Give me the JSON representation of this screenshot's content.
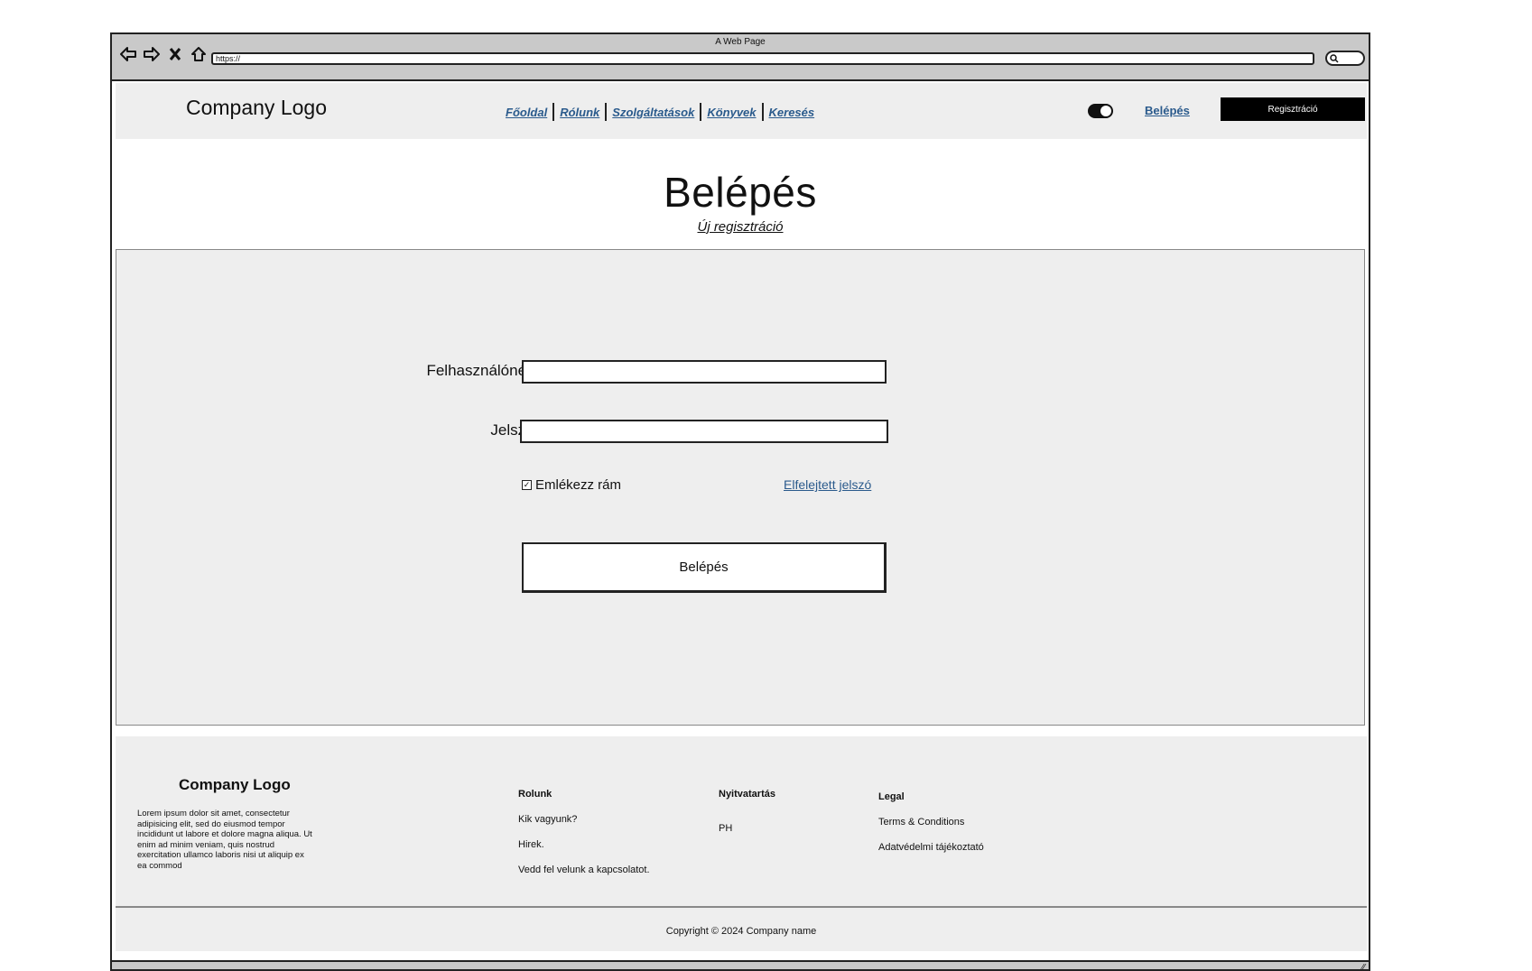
{
  "window": {
    "title": "A Web Page",
    "url": "https://"
  },
  "icons": {
    "back": "back-arrow-icon",
    "forward": "forward-arrow-icon",
    "stop": "close-icon",
    "home": "home-icon",
    "search": "search-icon"
  },
  "header": {
    "logo": "Company Logo",
    "nav": [
      "Főoldal",
      "Rólunk",
      "Szolgáltatások",
      "Könyvek",
      "Keresés"
    ],
    "login_link": "Belépés",
    "register_button": "Regisztráció"
  },
  "main": {
    "title": "Belépés",
    "subtitle_link": "Új regisztráció"
  },
  "form": {
    "username_label": "Felhasználónév :",
    "username_value": "",
    "password_label": "Jelszó :",
    "password_value": "",
    "remember_label": "Emlékezz rám",
    "remember_checked": true,
    "forgot_link": "Elfelejtett jelszó",
    "submit_label": "Belépés"
  },
  "footer": {
    "logo": "Company Logo",
    "lorem": "Lorem ipsum dolor sit amet, consectetur adipisicing elit, sed do eiusmod tempor incididunt ut labore et dolore magna aliqua. Ut enim ad minim veniam, quis nostrud exercitation ullamco laboris nisi ut aliquip ex ea commod",
    "col1": {
      "heading": "Rolunk",
      "items": [
        "Kik vagyunk?",
        "Hirek.",
        "Vedd fel velunk a kapcsolatot."
      ]
    },
    "col2": {
      "heading": "Nyitvatartás",
      "items": [
        "PH"
      ]
    },
    "col3": {
      "heading": "Legal",
      "items": [
        "Terms & Conditions",
        "Adatvédelmi tájékoztató"
      ]
    },
    "copyright": "Copyright © 2024 Company name"
  },
  "colors": {
    "link": "#2a5a8c",
    "panel": "#eeeeee",
    "chrome": "#c9c9c9",
    "button_dark": "#000000"
  }
}
